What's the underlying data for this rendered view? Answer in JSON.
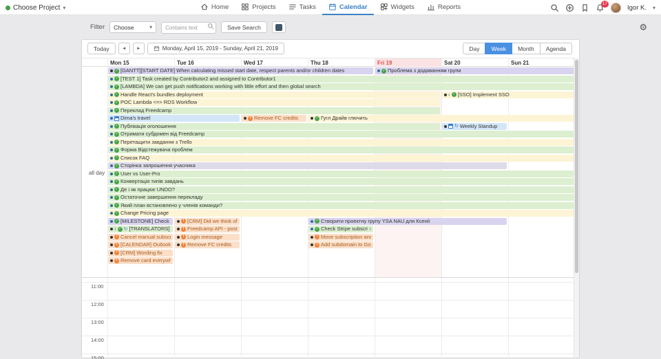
{
  "header": {
    "project_selector": {
      "label": "Choose Project"
    },
    "nav": [
      {
        "label": "Home",
        "icon": "home-icon",
        "active": false
      },
      {
        "label": "Projects",
        "icon": "projects-icon",
        "active": false
      },
      {
        "label": "Tasks",
        "icon": "tasks-icon",
        "active": false
      },
      {
        "label": "Calendar",
        "icon": "calendar-icon",
        "active": true
      },
      {
        "label": "Widgets",
        "icon": "widgets-icon",
        "active": false
      },
      {
        "label": "Reports",
        "icon": "reports-icon",
        "active": false
      }
    ],
    "notifications_badge": "17",
    "user_name": "Igor K."
  },
  "filter_bar": {
    "label": "Filter",
    "filter_dropdown_value": "Choose",
    "search_placeholder": "Contains text",
    "save_search_label": "Save Search"
  },
  "toolbar": {
    "today_label": "Today",
    "date_range": "Monday, April 15, 2019 - Sunday, April 21, 2019",
    "views": [
      "Day",
      "Week",
      "Month",
      "Agenda"
    ],
    "active_view": "Week"
  },
  "calendar": {
    "all_day_label": "all day",
    "days": [
      {
        "label": "Mon 15",
        "today": false
      },
      {
        "label": "Tue 16",
        "today": false
      },
      {
        "label": "Wed 17",
        "today": false
      },
      {
        "label": "Thu 18",
        "today": false
      },
      {
        "label": "Fri 19",
        "today": true
      },
      {
        "label": "Sat 20",
        "today": false
      },
      {
        "label": "Sun 21",
        "today": false
      }
    ],
    "hours": [
      "11:00",
      "12:00",
      "13:00",
      "14:00",
      "15:00"
    ],
    "events": [
      {
        "row": 0,
        "col": 0,
        "span": 4,
        "type": "lavender",
        "bullet": "#333333",
        "icons": [
          "check"
        ],
        "text": "[GANTT][START DATE] When calculating missed start date, respect parents and/or children dates"
      },
      {
        "row": 0,
        "col": 4,
        "span": 3,
        "type": "lavender",
        "bullet": "#2e6da4",
        "icons": [
          "check"
        ],
        "text": "Проблема з додаванням групи"
      },
      {
        "row": 1,
        "col": 0,
        "span": 7,
        "type": "green",
        "bullet": "#2e6da4",
        "icons": [
          "check"
        ],
        "text": "[TEST 1] Task created by Contributor2 and assigned to Contributor1"
      },
      {
        "row": 2,
        "col": 0,
        "span": 7,
        "type": "green",
        "bullet": "#2e6da4",
        "icons": [
          "check"
        ],
        "text": "[LAMBDA] We can get push notifications working with little effort and then global search"
      },
      {
        "row": 3,
        "col": 0,
        "span": 5,
        "type": "yellow",
        "bullet": "#2e6da4",
        "icons": [
          "check"
        ],
        "text": "Handle React's bundles deployment"
      },
      {
        "row": 3,
        "col": 5,
        "span": 2,
        "type": "yellow",
        "bullet": "#333333",
        "cont_left": true,
        "icons": [
          "check"
        ],
        "text": "[SSO] Implement SSO"
      },
      {
        "row": 4,
        "col": 0,
        "span": 5,
        "type": "yellow",
        "bullet": "#2e6da4",
        "icons": [
          "check"
        ],
        "text": "POC Lambda <=> RDS Workflow"
      },
      {
        "row": 5,
        "col": 0,
        "span": 5,
        "type": "green",
        "bullet": "#2e6da4",
        "icons": [
          "check"
        ],
        "text": "Переклад Freedcamp"
      },
      {
        "row": 6,
        "col": 0,
        "span": 2,
        "type": "blue",
        "bullet": "#2e6da4",
        "icons": [
          "calendar"
        ],
        "text": "Dima's travel"
      },
      {
        "row": 6,
        "col": 2,
        "span": 1,
        "type": "orange",
        "bullet": "#333333",
        "icons": [
          "issue"
        ],
        "text": "Remove FC credits"
      },
      {
        "row": 6,
        "col": 3,
        "span": 4,
        "type": "yellow",
        "bullet": "#333333",
        "icons": [
          "check"
        ],
        "text": "Гугл Драйв глючить"
      },
      {
        "row": 7,
        "col": 0,
        "span": 5,
        "type": "green",
        "bullet": "#2e6da4",
        "icons": [
          "check"
        ],
        "text": "Публікація оголошення"
      },
      {
        "row": 7,
        "col": 5,
        "span": 1,
        "type": "blue",
        "bullet": "#333333",
        "icons": [
          "calendar",
          "repeat"
        ],
        "text": "Weekly Standup"
      },
      {
        "row": 8,
        "col": 0,
        "span": 7,
        "type": "green",
        "bullet": "#2e6da4",
        "icons": [
          "check"
        ],
        "text": "Отримати субдомен від Freedcamp"
      },
      {
        "row": 9,
        "col": 0,
        "span": 7,
        "type": "yellow",
        "bullet": "#2e6da4",
        "icons": [
          "check"
        ],
        "text": "Перетащити завдання з Trello"
      },
      {
        "row": 10,
        "col": 0,
        "span": 7,
        "type": "green",
        "bullet": "#2e6da4",
        "icons": [
          "check"
        ],
        "text": "Форма Відстежувача проблем"
      },
      {
        "row": 11,
        "col": 0,
        "span": 7,
        "type": "yellow",
        "bullet": "#2e6da4",
        "icons": [
          "check"
        ],
        "text": "Список FAQ"
      },
      {
        "row": 12,
        "col": 0,
        "span": 6,
        "type": "gray",
        "bullet": "#2e6da4",
        "icons": [
          "check"
        ],
        "text": "Сторінка запрошення учасника"
      },
      {
        "row": 13,
        "col": 0,
        "span": 7,
        "type": "green",
        "bullet": "#2e6da4",
        "icons": [
          "check"
        ],
        "text": "User vs User-Pro"
      },
      {
        "row": 14,
        "col": 0,
        "span": 7,
        "type": "green",
        "bullet": "#2e6da4",
        "icons": [
          "check"
        ],
        "text": "Конвертація типів завдань"
      },
      {
        "row": 15,
        "col": 0,
        "span": 7,
        "type": "green",
        "bullet": "#2e6da4",
        "icons": [
          "check"
        ],
        "text": "Де і як працює UNDO?"
      },
      {
        "row": 16,
        "col": 0,
        "span": 7,
        "type": "green",
        "bullet": "#2e6da4",
        "icons": [
          "check"
        ],
        "text": "Остаточне завершення перекладу"
      },
      {
        "row": 17,
        "col": 0,
        "span": 7,
        "type": "green",
        "bullet": "#2e6da4",
        "icons": [
          "check"
        ],
        "text": "Який план встановлено у членів команди?"
      },
      {
        "row": 18,
        "col": 0,
        "span": 7,
        "type": "yellow",
        "bullet": "#2e6da4",
        "icons": [
          "check"
        ],
        "text": "Change Pricing page"
      },
      {
        "row": 19,
        "col": 0,
        "span": 1,
        "type": "lavender",
        "bullet": "#2e6da4",
        "icons": [
          "check"
        ],
        "text": "[MILESTONE] Check resul..."
      },
      {
        "row": 19,
        "col": 1,
        "span": 1,
        "type": "orange",
        "bullet": "#333333",
        "icons": [
          "issue"
        ],
        "text": "[CRM] Did we think of ho..."
      },
      {
        "row": 19,
        "col": 3,
        "span": 3,
        "type": "lavender",
        "bullet": "#2e6da4",
        "icons": [
          "check"
        ],
        "text": "Створити проектну групу YSA NAU для Ксенії"
      },
      {
        "row": 20,
        "col": 0,
        "span": 1,
        "type": "green",
        "bullet": "#333333",
        "cont_left": true,
        "icons": [
          "check",
          "repeat"
        ],
        "text": "[TRANSLATORS] Pr..."
      },
      {
        "row": 20,
        "col": 1,
        "span": 1,
        "type": "orange",
        "bullet": "#333333",
        "icons": [
          "issue"
        ],
        "text": "Freedcamp API - post to ..."
      },
      {
        "row": 20,
        "col": 3,
        "span": 1,
        "type": "green",
        "bullet": "#2e6da4",
        "cont_right": true,
        "icons": [
          "check"
        ],
        "text": "Check Stripe subscripti..."
      },
      {
        "row": 21,
        "col": 0,
        "span": 1,
        "type": "orange",
        "bullet": "#333333",
        "icons": [
          "issue"
        ],
        "text": "Cancel manual subscripti..."
      },
      {
        "row": 21,
        "col": 1,
        "span": 1,
        "type": "orange",
        "bullet": "#333333",
        "icons": [
          "issue"
        ],
        "text": "Login message"
      },
      {
        "row": 21,
        "col": 3,
        "span": 1,
        "type": "orange",
        "bullet": "#333333",
        "icons": [
          "issue"
        ],
        "text": "Move subscription and CC"
      },
      {
        "row": 22,
        "col": 0,
        "span": 1,
        "type": "orange",
        "bullet": "#333333",
        "icons": [
          "issue"
        ],
        "text": "[CALENDAR] Outlook cale..."
      },
      {
        "row": 22,
        "col": 1,
        "span": 1,
        "type": "orange",
        "bullet": "#333333",
        "icons": [
          "issue"
        ],
        "text": "Remove FC credits"
      },
      {
        "row": 22,
        "col": 3,
        "span": 1,
        "type": "orange",
        "bullet": "#333333",
        "icons": [
          "issue"
        ],
        "text": "Add subdomain to Google"
      },
      {
        "row": 23,
        "col": 0,
        "span": 1,
        "type": "orange",
        "bullet": "#333333",
        "icons": [
          "issue"
        ],
        "text": "[CRM] Wording fix"
      },
      {
        "row": 24,
        "col": 0,
        "span": 1,
        "type": "orange",
        "bullet": "#333333",
        "icons": [
          "issue"
        ],
        "text": "Remove card everywhere"
      }
    ]
  },
  "glyphs": {
    "caret_down": "▾",
    "prev": "◄",
    "next": "►",
    "gear": "⚙",
    "check": "✓",
    "issue": "!",
    "repeat": "↻",
    "cont_left": "‹",
    "cont_right": "›"
  },
  "colors": {
    "accent_blue": "#4a90e2",
    "today_red": "#d9534f",
    "event_green": "#dcefd0",
    "event_yellow": "#fcf4d4",
    "event_lavender": "#d8d3ee",
    "event_blue": "#d2e6f7",
    "event_orange": "#fbdfc9",
    "event_gray": "#dddbe8"
  }
}
